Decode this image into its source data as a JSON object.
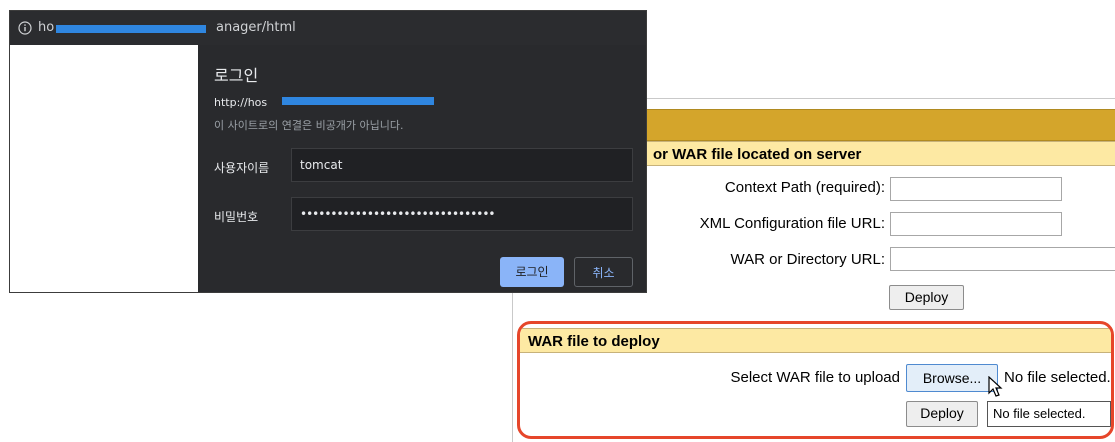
{
  "login_dialog": {
    "url_prefix": "ho",
    "url_suffix": "anager/html",
    "title": "로그인",
    "site_url": "http://hos",
    "notice": "이 사이트로의 연결은 비공개가 아닙니다.",
    "username_label": "사용자이름",
    "username_value": "tomcat",
    "password_label": "비밀번호",
    "password_value": "••••••••••••••••••••••••••••••••",
    "login_button": "로그인",
    "cancel_button": "취소",
    "colors": {
      "primary_button": "#8ab4f8",
      "background": "#292a2d",
      "redaction": "#2f86e0"
    }
  },
  "tomcat_manager": {
    "server_section": {
      "title": "or WAR file located on server",
      "fields": [
        {
          "label": "Context Path (required):",
          "value": ""
        },
        {
          "label": "XML Configuration file URL:",
          "value": ""
        },
        {
          "label": "WAR or Directory URL:",
          "value": ""
        }
      ],
      "deploy_button": "Deploy"
    },
    "war_section": {
      "title": "WAR file to deploy",
      "select_label": "Select WAR file to upload",
      "browse_button": "Browse...",
      "file_status": "No file selected.",
      "deploy_button": "Deploy",
      "tooltip": "No file selected."
    },
    "colors": {
      "header_bar": "#d4a52b",
      "section_header": "#fde9a3",
      "highlight_border": "#e6462a"
    }
  }
}
